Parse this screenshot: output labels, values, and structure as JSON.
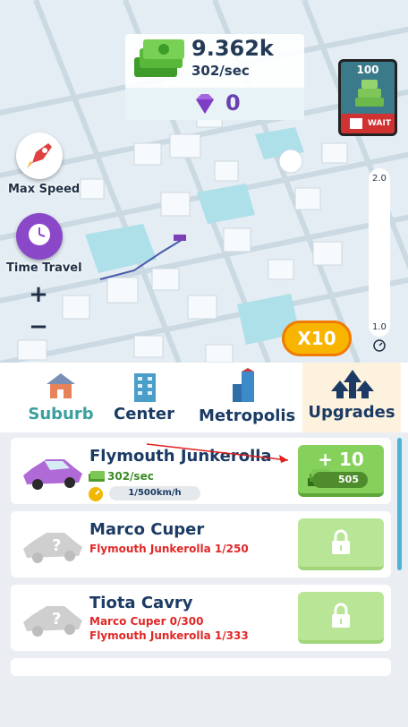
{
  "hud": {
    "money": "9.362k",
    "rate": "302/sec",
    "gems": "0"
  },
  "ad": {
    "amount": "100",
    "wait_label": "WAIT"
  },
  "side_buttons": [
    {
      "label": "Max Speed",
      "icon": "rocket-icon"
    },
    {
      "label": "Time Travel",
      "icon": "clock-pin-icon"
    }
  ],
  "zoom": {
    "plus": "+",
    "minus": "−"
  },
  "speed_slider": {
    "max_label": "2.0",
    "min_label": "1.0"
  },
  "multiplier": {
    "label": "X10"
  },
  "tabs": [
    {
      "label": "Suburb",
      "icon": "house-icon",
      "color": "#3aa0a0"
    },
    {
      "label": "Center",
      "icon": "office-building-icon",
      "color": "#1b3b64"
    },
    {
      "label": "Metropolis",
      "icon": "skyscraper-icon",
      "color": "#1b3b64"
    },
    {
      "label": "Upgrades",
      "icon": "upgrade-arrows-icon",
      "color": "#1b3b64"
    }
  ],
  "cars": [
    {
      "name": "Flymouth Junkerolla",
      "rate": "302/sec",
      "speed": "1/500km/h",
      "buy_label": "+ 10",
      "cost": "505",
      "locked": false
    },
    {
      "name": "Marco Cuper",
      "requirements": [
        "Flymouth Junkerolla 1/250"
      ],
      "locked": true
    },
    {
      "name": "Tiota Cavry",
      "requirements": [
        "Marco Cuper 0/300",
        "Flymouth Junkerolla 1/333"
      ],
      "locked": true
    }
  ],
  "colors": {
    "accent_green": "#86d05c",
    "gem_purple": "#6a3fb0",
    "text_navy": "#1b3b64",
    "multiplier_orange": "#f7b500"
  }
}
